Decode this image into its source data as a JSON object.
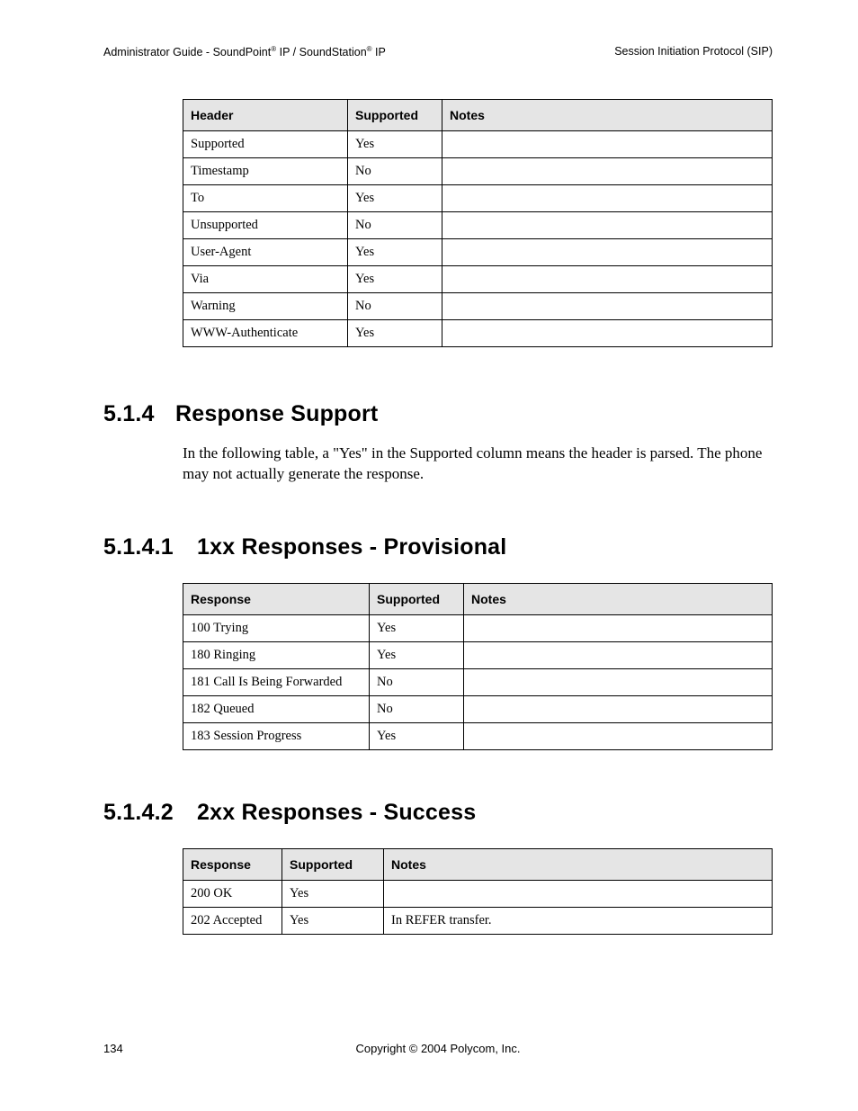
{
  "header": {
    "left_pre": "Administrator Guide - SoundPoint",
    "left_mid": " IP / SoundStation",
    "left_post": " IP",
    "reg": "®",
    "right": "Session Initiation Protocol (SIP)"
  },
  "table1": {
    "headers": [
      "Header",
      "Supported",
      "Notes"
    ],
    "rows": [
      {
        "c0": "Supported",
        "c1": "Yes",
        "c2": ""
      },
      {
        "c0": "Timestamp",
        "c1": "No",
        "c2": ""
      },
      {
        "c0": "To",
        "c1": "Yes",
        "c2": ""
      },
      {
        "c0": "Unsupported",
        "c1": "No",
        "c2": ""
      },
      {
        "c0": "User-Agent",
        "c1": "Yes",
        "c2": ""
      },
      {
        "c0": "Via",
        "c1": "Yes",
        "c2": ""
      },
      {
        "c0": "Warning",
        "c1": "No",
        "c2": ""
      },
      {
        "c0": "WWW-Authenticate",
        "c1": "Yes",
        "c2": ""
      }
    ]
  },
  "section514": {
    "num": "5.1.4",
    "title": "Response Support",
    "body": "In the following table, a \"Yes\" in the Supported column means the header is parsed. The phone may not actually generate the response."
  },
  "section5141": {
    "num": "5.1.4.1",
    "title": "1xx Responses - Provisional"
  },
  "table2": {
    "headers": [
      "Response",
      "Supported",
      "Notes"
    ],
    "rows": [
      {
        "c0": "100 Trying",
        "c1": "Yes",
        "c2": ""
      },
      {
        "c0": "180 Ringing",
        "c1": "Yes",
        "c2": ""
      },
      {
        "c0": "181 Call Is Being Forwarded",
        "c1": "No",
        "c2": ""
      },
      {
        "c0": "182 Queued",
        "c1": "No",
        "c2": ""
      },
      {
        "c0": "183 Session Progress",
        "c1": "Yes",
        "c2": ""
      }
    ]
  },
  "section5142": {
    "num": "5.1.4.2",
    "title": "2xx Responses - Success"
  },
  "table3": {
    "headers": [
      "Response",
      "Supported",
      "Notes"
    ],
    "rows": [
      {
        "c0": "200 OK",
        "c1": "Yes",
        "c2": ""
      },
      {
        "c0": "202 Accepted",
        "c1": "Yes",
        "c2": "In REFER transfer."
      }
    ]
  },
  "footer": {
    "page": "134",
    "copyright": "Copyright © 2004 Polycom, Inc."
  }
}
